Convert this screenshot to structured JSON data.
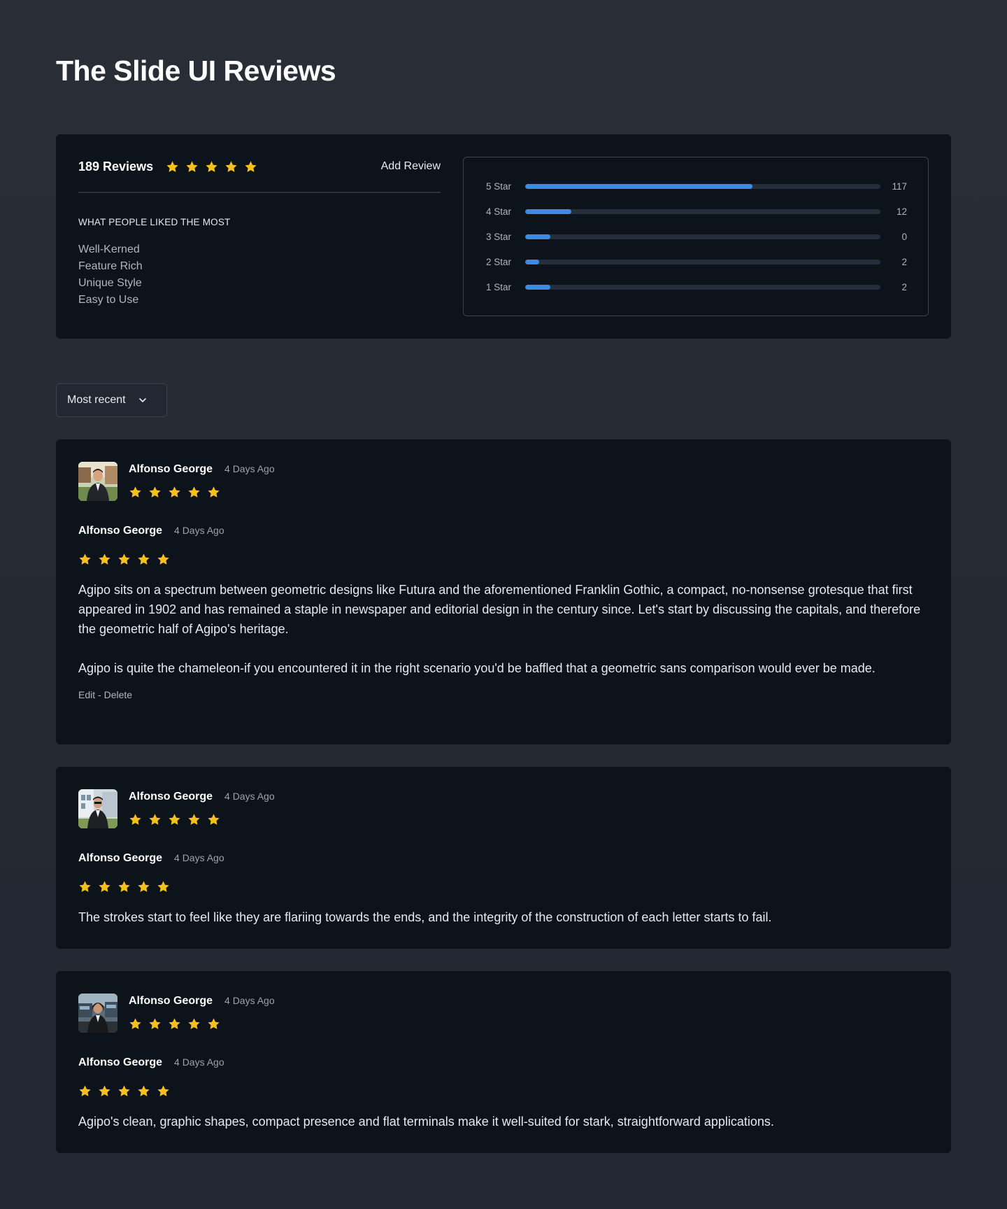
{
  "page": {
    "title": "The Slide UI Reviews"
  },
  "summary": {
    "review_count": "189 Reviews",
    "rating": 5,
    "add_review_label": "Add Review",
    "liked_heading": "WHAT PEOPLE LIKED THE MOST",
    "liked": [
      "Well-Kerned",
      "Feature Rich",
      "Unique Style",
      "Easy to Use"
    ],
    "distribution": [
      {
        "label": "5 Star",
        "count": "117",
        "fill_fraction": 0.64
      },
      {
        "label": "4 Star",
        "count": "12",
        "fill_fraction": 0.13
      },
      {
        "label": "3 Star",
        "count": "0",
        "fill_fraction": 0.07
      },
      {
        "label": "2 Star",
        "count": "2",
        "fill_fraction": 0.04
      },
      {
        "label": "1 Star",
        "count": "2",
        "fill_fraction": 0.07
      }
    ]
  },
  "sort": {
    "label": "Most recent",
    "icon": "chevron-down-icon"
  },
  "reviews": [
    {
      "author": "Alfonso George",
      "date": "4 Days Ago",
      "rating": 5,
      "paragraphs": [
        "Agipo sits on a spectrum between geometric designs like Futura and the aforementioned Franklin Gothic, a compact, no-nonsense grotesque that first appeared in 1902 and has remained a staple in newspaper and editorial design in the century since. Let's start by discussing the capitals, and therefore the geometric half of Agipo's heritage.",
        "Agipo is quite the chameleon-if you encountered it in the right scenario you'd be baffled that a geometric sans comparison would ever be made."
      ],
      "edit_label": "Edit",
      "separator": " - ",
      "delete_label": "Delete"
    },
    {
      "author": "Alfonso George",
      "date": "4 Days Ago",
      "rating": 5,
      "paragraphs": [
        "The strokes start to feel like they are flariing towards the ends, and the integrity of the construction of each letter starts to fail."
      ]
    },
    {
      "author": "Alfonso George",
      "date": "4 Days Ago",
      "rating": 5,
      "paragraphs": [
        "Agipo's clean, graphic shapes, compact presence and flat terminals make it well-suited for stark, straightforward applications."
      ]
    }
  ],
  "colors": {
    "background": "#252b33",
    "card": "#0d131b",
    "accent_bar": "#3e8be6",
    "star": "#f6c01a",
    "muted_text": "#aeb6c1"
  }
}
